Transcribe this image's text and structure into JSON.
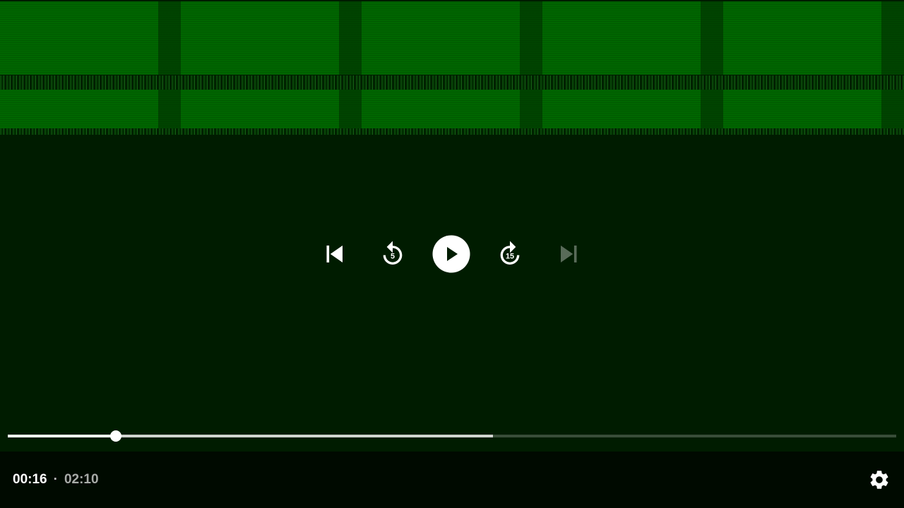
{
  "player": {
    "current_time": "00:16",
    "separator": "·",
    "duration": "02:10",
    "progress_percent": 12.2,
    "buffered_percent": 54.6,
    "state": "paused",
    "rewind_seconds": "5",
    "forward_seconds": "15",
    "next_enabled": false
  },
  "icons": {
    "previous": "skip-previous-icon",
    "rewind": "replay-5-icon",
    "play": "play-icon",
    "forward": "forward-15-icon",
    "next": "skip-next-icon",
    "settings": "gear-icon"
  },
  "colors": {
    "video_green": "#006600",
    "background": "#001c00",
    "bottom_bar": "#000a00",
    "accent": "#ffffff"
  }
}
